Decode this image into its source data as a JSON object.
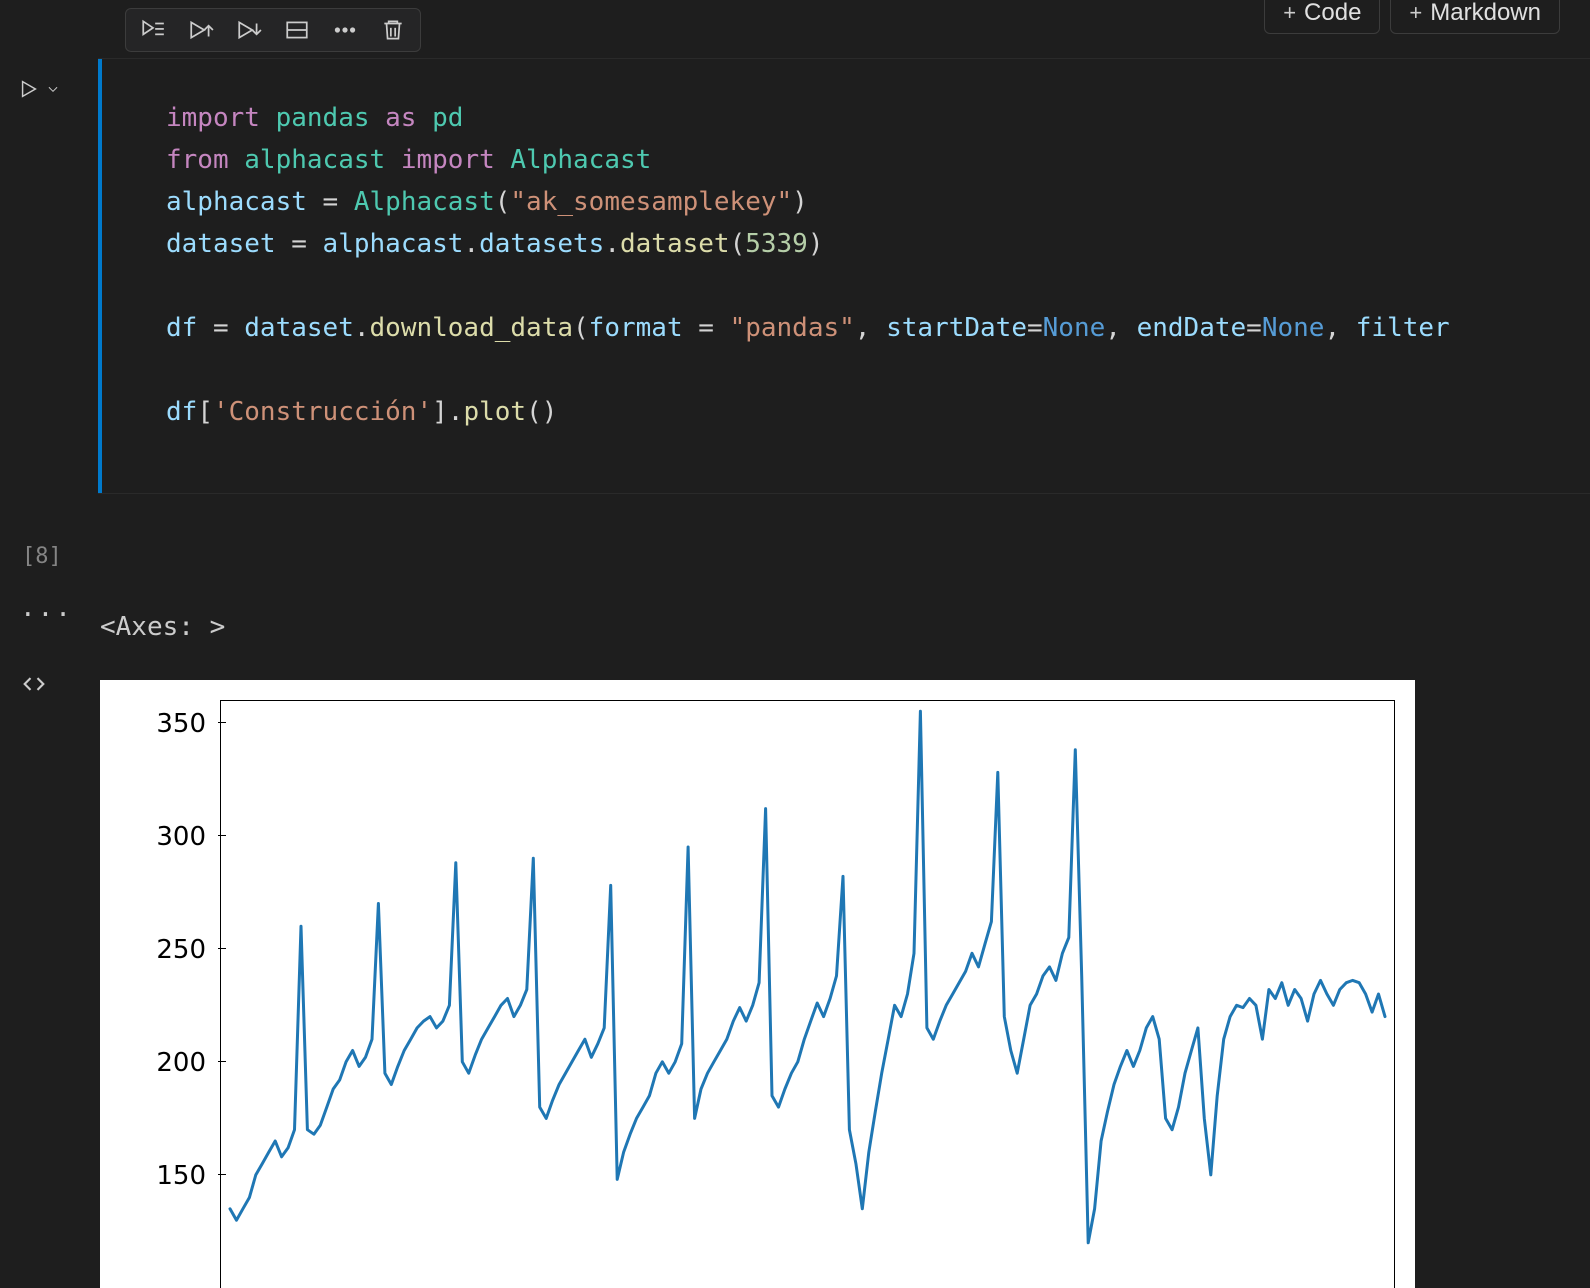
{
  "top_buttons": {
    "code": "Code",
    "markdown": "Markdown"
  },
  "exec_count": "[8]",
  "output_repr": "<Axes: >",
  "code_tokens": {
    "l1": {
      "import": "import",
      "pandas": "pandas",
      "as": "as",
      "pd": "pd"
    },
    "l2": {
      "from": "from",
      "alphacast_mod": "alphacast",
      "import": "import",
      "Alphacast": "Alphacast"
    },
    "l3": {
      "alphacast": "alphacast",
      "eq": "=",
      "Alphacast": "Alphacast",
      "lp": "(",
      "key": "\"ak_somesamplekey\"",
      "rp": ")"
    },
    "l4": {
      "dataset": "dataset",
      "eq": "=",
      "alphacast": "alphacast",
      "dot1": ".",
      "datasets": "datasets",
      "dot2": ".",
      "dataset_fn": "dataset",
      "lp": "(",
      "num": "5339",
      "rp": ")"
    },
    "l6": {
      "df": "df",
      "eq": "=",
      "dataset": "dataset",
      "dot": ".",
      "download_data": "download_data",
      "lp": "(",
      "format": "format",
      "eq2": "=",
      "pandas_str": "\"pandas\"",
      "c1": ",",
      "startDate": "startDate",
      "eq3": "=",
      "none1": "None",
      "c2": ",",
      "endDate": "endDate",
      "eq4": "=",
      "none2": "None",
      "c3": ",",
      "filter": "filter"
    },
    "l8": {
      "df": "df",
      "lb": "[",
      "col": "'Construcción'",
      "rb": "]",
      "dot": ".",
      "plot": "plot",
      "lp": "(",
      "rp": ")"
    }
  },
  "colors": {
    "accent": "#007acc",
    "chart_line": "#1f77b4"
  },
  "chart_data": {
    "type": "line",
    "title": "",
    "xlabel": "",
    "ylabel": "",
    "ylim": [
      100,
      360
    ],
    "yticks": [
      150,
      200,
      250,
      300,
      350
    ],
    "values": [
      135,
      130,
      135,
      140,
      150,
      155,
      160,
      165,
      158,
      162,
      170,
      260,
      170,
      168,
      172,
      180,
      188,
      192,
      200,
      205,
      198,
      202,
      210,
      270,
      195,
      190,
      198,
      205,
      210,
      215,
      218,
      220,
      215,
      218,
      225,
      288,
      200,
      195,
      203,
      210,
      215,
      220,
      225,
      228,
      220,
      225,
      232,
      290,
      180,
      175,
      183,
      190,
      195,
      200,
      205,
      210,
      202,
      208,
      215,
      278,
      148,
      160,
      168,
      175,
      180,
      185,
      195,
      200,
      195,
      200,
      208,
      295,
      175,
      188,
      195,
      200,
      205,
      210,
      218,
      224,
      218,
      225,
      235,
      312,
      185,
      180,
      188,
      195,
      200,
      210,
      218,
      226,
      220,
      228,
      238,
      282,
      170,
      155,
      135,
      160,
      178,
      195,
      210,
      225,
      220,
      230,
      248,
      355,
      215,
      210,
      218,
      225,
      230,
      235,
      240,
      248,
      242,
      252,
      262,
      328,
      220,
      205,
      195,
      210,
      225,
      230,
      238,
      242,
      236,
      248,
      255,
      338,
      238,
      120,
      135,
      165,
      178,
      190,
      198,
      205,
      198,
      205,
      215,
      220,
      210,
      175,
      170,
      180,
      195,
      205,
      215,
      175,
      150,
      185,
      210,
      220,
      225,
      224,
      228,
      225,
      210,
      232,
      228,
      235,
      225,
      232,
      228,
      218,
      230,
      236,
      230,
      225,
      232,
      235,
      236,
      235,
      230,
      222,
      230,
      220
    ]
  }
}
